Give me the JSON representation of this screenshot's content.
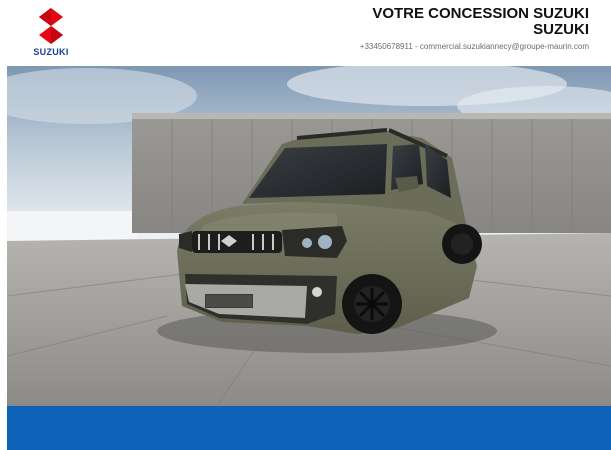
{
  "header": {
    "logo_text": "SUZUKI",
    "dealer_line1": "VOTRE CONCESSION SUZUKI",
    "dealer_line2": "SUZUKI",
    "phone": "+33450678911",
    "separator": " - ",
    "email": "commercial.suzukiannecy@groupe-maurin.com"
  },
  "hero": {
    "subject": "car-photo",
    "brand_color": "#e30613"
  },
  "band": {
    "color": "#0e62b8"
  }
}
